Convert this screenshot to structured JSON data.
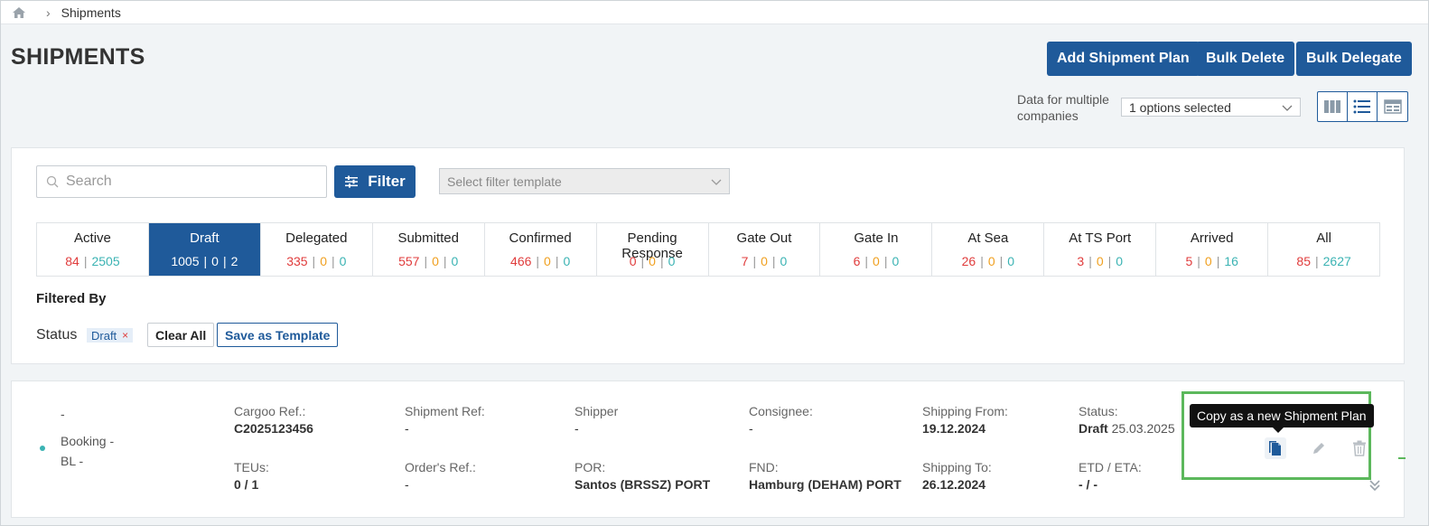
{
  "breadcrumb": {
    "current": "Shipments"
  },
  "page": {
    "title": "SHIPMENTS"
  },
  "header_actions": {
    "add_plan": "Add Shipment Plan",
    "bulk_delete": "Bulk Delete",
    "bulk_delegate": "Bulk Delegate"
  },
  "companies": {
    "label": "Data for multiple companies",
    "selected": "1 options selected"
  },
  "search": {
    "placeholder": "Search",
    "value": ""
  },
  "filter": {
    "label": "Filter",
    "template_placeholder": "Select filter template"
  },
  "status_tabs": [
    {
      "name": "Active",
      "counts": [
        "84",
        "2505"
      ],
      "colors": [
        "red",
        "teal"
      ]
    },
    {
      "name": "Draft",
      "counts": [
        "1005",
        "0",
        "2"
      ],
      "colors": [
        "white",
        "white",
        "white"
      ],
      "active": true
    },
    {
      "name": "Delegated",
      "counts": [
        "335",
        "0",
        "0"
      ],
      "colors": [
        "red",
        "orange",
        "teal"
      ]
    },
    {
      "name": "Submitted",
      "counts": [
        "557",
        "0",
        "0"
      ],
      "colors": [
        "red",
        "orange",
        "teal"
      ]
    },
    {
      "name": "Confirmed",
      "counts": [
        "466",
        "0",
        "0"
      ],
      "colors": [
        "red",
        "orange",
        "teal"
      ]
    },
    {
      "name": "Pending Response",
      "counts": [
        "0",
        "0",
        "0"
      ],
      "colors": [
        "red",
        "orange",
        "teal"
      ]
    },
    {
      "name": "Gate Out",
      "counts": [
        "7",
        "0",
        "0"
      ],
      "colors": [
        "red",
        "orange",
        "teal"
      ]
    },
    {
      "name": "Gate In",
      "counts": [
        "6",
        "0",
        "0"
      ],
      "colors": [
        "red",
        "orange",
        "teal"
      ]
    },
    {
      "name": "At Sea",
      "counts": [
        "26",
        "0",
        "0"
      ],
      "colors": [
        "red",
        "orange",
        "teal"
      ]
    },
    {
      "name": "At TS Port",
      "counts": [
        "3",
        "0",
        "0"
      ],
      "colors": [
        "red",
        "orange",
        "teal"
      ]
    },
    {
      "name": "Arrived",
      "counts": [
        "5",
        "0",
        "16"
      ],
      "colors": [
        "red",
        "orange",
        "teal"
      ]
    },
    {
      "name": "All",
      "counts": [
        "85",
        "2627"
      ],
      "colors": [
        "red",
        "teal"
      ]
    }
  ],
  "filtered_by": {
    "title": "Filtered By",
    "status_label": "Status",
    "chip": "Draft",
    "chip_remove": "×",
    "clear_all": "Clear All",
    "save_template": "Save as Template"
  },
  "shipment": {
    "ref_dash": "-",
    "booking": "Booking -",
    "bl": "BL -",
    "cargoo_ref": {
      "label": "Cargoo Ref.:",
      "value": "C2025123456"
    },
    "teus": {
      "label": "TEUs:",
      "value": "0 / 1"
    },
    "shipment_ref": {
      "label": "Shipment Ref:",
      "value": "-"
    },
    "orders_ref": {
      "label": "Order's Ref.:",
      "value": "-"
    },
    "shipper": {
      "label": "Shipper",
      "value": "-"
    },
    "por": {
      "label": "POR:",
      "value": "Santos (BRSSZ) PORT"
    },
    "consignee": {
      "label": "Consignee:",
      "value": "-"
    },
    "fnd": {
      "label": "FND:",
      "value": "Hamburg (DEHAM) PORT"
    },
    "shipping_from": {
      "label": "Shipping From:",
      "value": "19.12.2024"
    },
    "shipping_to": {
      "label": "Shipping To:",
      "value": "26.12.2024"
    },
    "status": {
      "label": "Status:",
      "value": "Draft",
      "date": "25.03.2025"
    },
    "etd_eta": {
      "label": "ETD / ETA:",
      "value": "- / -"
    }
  },
  "tooltip": {
    "copy": "Copy as a new Shipment Plan"
  },
  "colors": {
    "primary": "#1f5a9a",
    "red": "#e03c3c",
    "orange": "#f0a020",
    "teal": "#3bb3b3",
    "highlight": "#5cb85c"
  }
}
